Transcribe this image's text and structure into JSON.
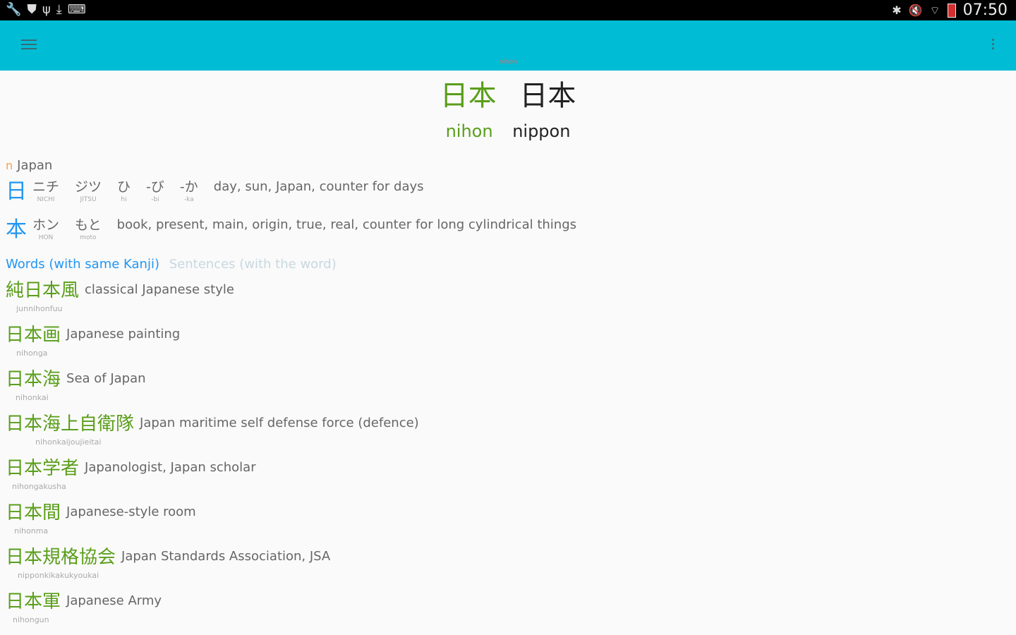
{
  "status_bar": {
    "left_icons": [
      "wrench-icon",
      "shield-icon",
      "usb-icon",
      "download-icon",
      "keyboard-icon"
    ],
    "right_icons": [
      "bluetooth-icon",
      "mute-icon",
      "wifi-icon",
      "battery-icon"
    ],
    "time": "07:50"
  },
  "appbar": {
    "subtitle": "nihon"
  },
  "word": {
    "kanji_primary": "日本",
    "kanji_secondary": "日本",
    "reading_primary": "nihon",
    "reading_secondary": "nippon"
  },
  "definition": {
    "pos": "n",
    "meaning": "Japan"
  },
  "kanji_breakdown": [
    {
      "kanji": "日",
      "readings": [
        {
          "kana": "ニチ",
          "romaji": "NICHI"
        },
        {
          "kana": "ジツ",
          "romaji": "JITSU"
        },
        {
          "kana": "ひ",
          "romaji": "hi"
        },
        {
          "kana": "-び",
          "romaji": "-bi"
        },
        {
          "kana": "-か",
          "romaji": "-ka"
        }
      ],
      "meaning": "day, sun, Japan, counter for days"
    },
    {
      "kanji": "本",
      "readings": [
        {
          "kana": "ホン",
          "romaji": "HON"
        },
        {
          "kana": "もと",
          "romaji": "moto"
        }
      ],
      "meaning": "book, present, main, origin, true, real, counter for long cylindrical things"
    }
  ],
  "tabs": {
    "active": "Words (with same Kanji)",
    "inactive": "Sentences (with the word)"
  },
  "words": [
    {
      "word": "純日本風",
      "meaning": "classical Japanese style",
      "reading": "junnihonfuu"
    },
    {
      "word": "日本画",
      "meaning": "Japanese painting",
      "reading": "nihonga"
    },
    {
      "word": "日本海",
      "meaning": "Sea of Japan",
      "reading": "nihonkai"
    },
    {
      "word": "日本海上自衛隊",
      "meaning": "Japan maritime self defense force (defence)",
      "reading": "nihonkaijoujieitai"
    },
    {
      "word": "日本学者",
      "meaning": "Japanologist, Japan scholar",
      "reading": "nihongakusha"
    },
    {
      "word": "日本間",
      "meaning": "Japanese-style room",
      "reading": "nihonma"
    },
    {
      "word": "日本規格協会",
      "meaning": "Japan Standards Association, JSA",
      "reading": "nipponkikakukyoukai"
    },
    {
      "word": "日本軍",
      "meaning": "Japanese Army",
      "reading": "nihongun"
    }
  ],
  "colors": {
    "appbar": "#00bcd4",
    "kanji_green": "#5a9e1a",
    "kanji_blue": "#2196f3",
    "pos_orange": "#f4a052"
  }
}
